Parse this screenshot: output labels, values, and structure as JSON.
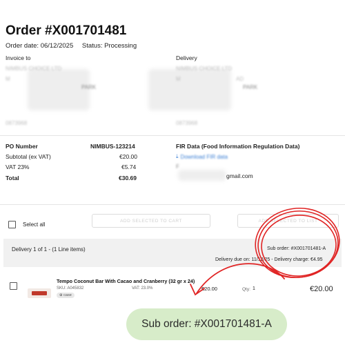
{
  "order": {
    "title": "Order #X001701481",
    "date": "Order date: 06/12/2025",
    "status": "Status: Processing"
  },
  "invoice": {
    "heading": "Invoice to",
    "line1": "NIMBUS CHOICE LTD",
    "line2": "M",
    "line3": "PARK",
    "line4": "0873968"
  },
  "delivery_address": {
    "heading": "Delivery",
    "line1": "NIMBUS CHOICE LTD",
    "line2": "M",
    "line2b": "AD",
    "line3": "PARK",
    "line4": "0873968"
  },
  "summary": {
    "po_label": "PO Number",
    "po_value": "NIMBUS-123214",
    "subtotal_label": "Subtotal (ex VAT)",
    "subtotal_value": "€20.00",
    "vat_label": "VAT 23%",
    "vat_value": "€5.74",
    "total_label": "Total",
    "total_value": "€30.69"
  },
  "fir": {
    "heading": "FIR Data (Food Information Regulation Data)",
    "link": "Download FIR data",
    "line2": "F",
    "email": "gmail.com"
  },
  "actions": {
    "select_all": "Select all",
    "add_to_cart": "ADD SELECTED TO CART",
    "add_to_list": "ADD SELECTED TO LIST"
  },
  "delivery_block": {
    "header": "Delivery 1 of 1 - (1 Line items)",
    "sub_order": "Sub order: #X001701481-A",
    "due": "Delivery due on: 11/12/25 - Delivery charge: €4.95"
  },
  "line_item": {
    "name": "Tempo Coconut Bar With Cacao and Cranberry (32 gr x 24)",
    "sku": "SKU: A045832",
    "unit_badge": "case",
    "vat": "VAT: 23.0%",
    "unit_price": "€20.00",
    "qty_label": "Qty:",
    "qty_value": "1",
    "line_total": "€20.00"
  },
  "callout": {
    "text": "Sub order: #X001701481-A",
    "color": "#d7ecc9",
    "annotation_color": "#e02424"
  }
}
